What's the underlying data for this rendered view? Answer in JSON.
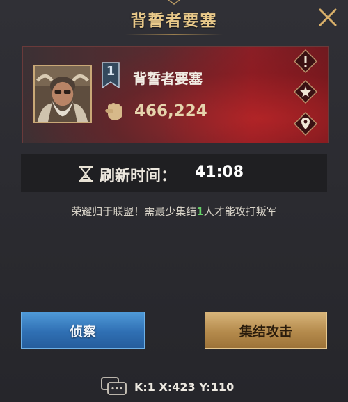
{
  "dialog": {
    "title": "背誓者要塞"
  },
  "boss": {
    "level": "1",
    "name": "背誓者要塞",
    "power": "466,224"
  },
  "side_icons": [
    "alert-icon",
    "star-icon",
    "location-pin-icon"
  ],
  "refresh": {
    "label": "刷新时间：",
    "time": "41:08"
  },
  "notice": {
    "prefix": "荣耀归于联盟！需最少集结",
    "count": "1",
    "suffix": "人才能攻打叛军"
  },
  "buttons": {
    "scout": "侦察",
    "rally": "集结攻击"
  },
  "coordinates": {
    "text": "K:1 X:423 Y:110"
  },
  "colors": {
    "title_gold": "#e9c98a",
    "card_red": "#8a1f26",
    "scout_blue": "#2f6fb3",
    "rally_gold": "#b48a4c",
    "highlight_green": "#67d46a"
  }
}
